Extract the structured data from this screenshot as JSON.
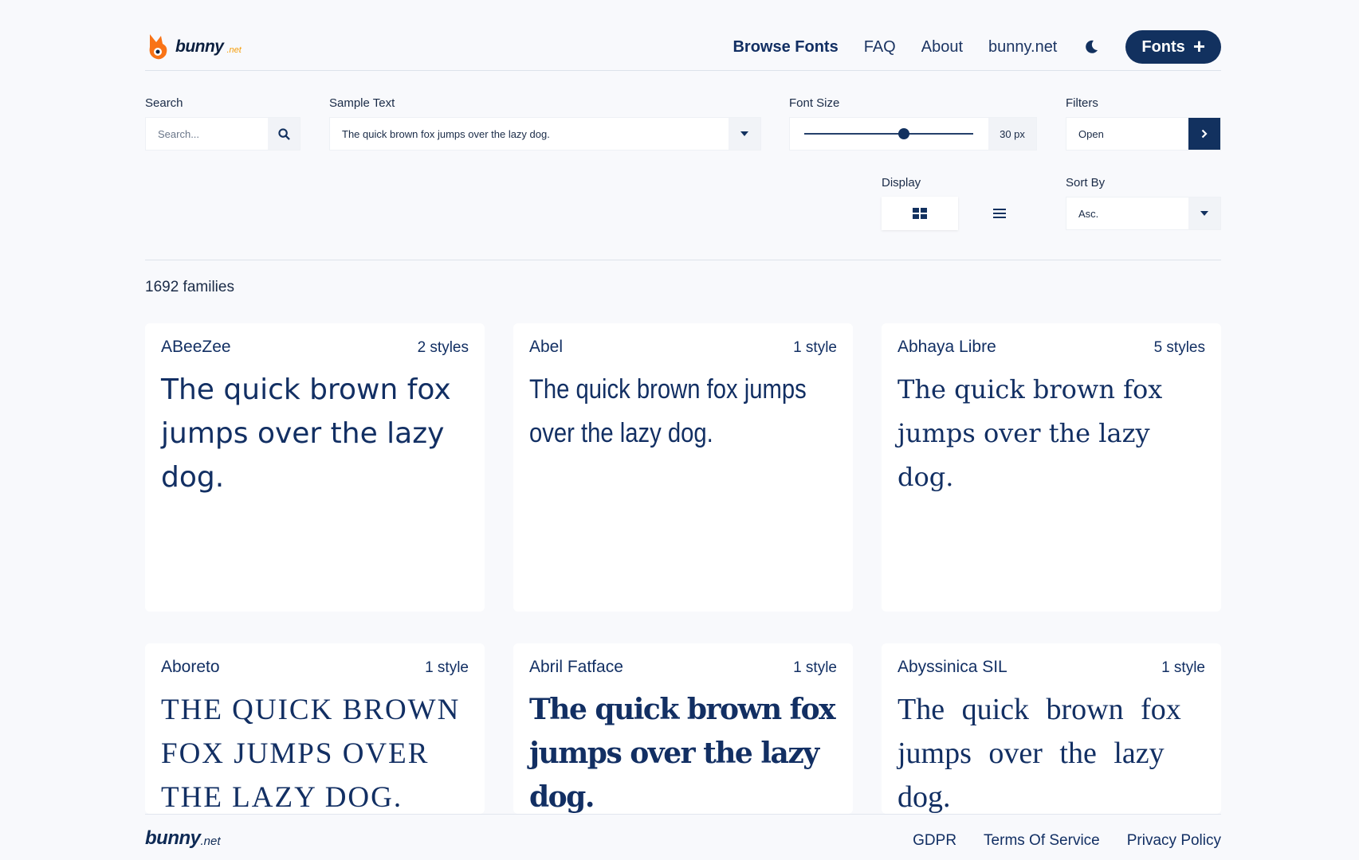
{
  "header": {
    "logo_text": "bunny",
    "logo_sub": ".net",
    "nav": [
      "Browse Fonts",
      "FAQ",
      "About",
      "bunny.net"
    ],
    "fonts_button": "Fonts"
  },
  "controls": {
    "search": {
      "label": "Search",
      "placeholder": "Search..."
    },
    "sample_text": {
      "label": "Sample Text",
      "value": "The quick brown fox jumps over the lazy dog."
    },
    "font_size": {
      "label": "Font Size",
      "value": "30 px",
      "level": 0.59
    },
    "filters": {
      "label": "Filters",
      "value": "Open"
    },
    "display": {
      "label": "Display",
      "selected": "grid"
    },
    "sort_by": {
      "label": "Sort By",
      "value": "Asc."
    }
  },
  "families_count": "1692 families",
  "fonts": [
    {
      "name": "ABeeZee",
      "styles": "2 styles",
      "sample": "The quick brown fox jumps over the lazy dog."
    },
    {
      "name": "Abel",
      "styles": "1 style",
      "sample": "The quick brown fox jumps over the lazy dog."
    },
    {
      "name": "Abhaya Libre",
      "styles": "5 styles",
      "sample": "The quick brown fox jumps over the lazy dog."
    },
    {
      "name": "Aboreto",
      "styles": "1 style",
      "sample": "The quick brown fox jumps over the lazy dog."
    },
    {
      "name": "Abril Fatface",
      "styles": "1 style",
      "sample": "The quick brown fox jumps over the lazy dog."
    },
    {
      "name": "Abyssinica SIL",
      "styles": "1 style",
      "sample": "The quick brown fox jumps over the lazy dog."
    }
  ],
  "footer": {
    "logo_text": "bunny",
    "logo_sub": ".net",
    "links": [
      "GDPR",
      "Terms Of Service",
      "Privacy Policy"
    ]
  },
  "colors": {
    "primary": "#12315f",
    "accent": "#f59e0b",
    "background": "#f8f9fc"
  }
}
